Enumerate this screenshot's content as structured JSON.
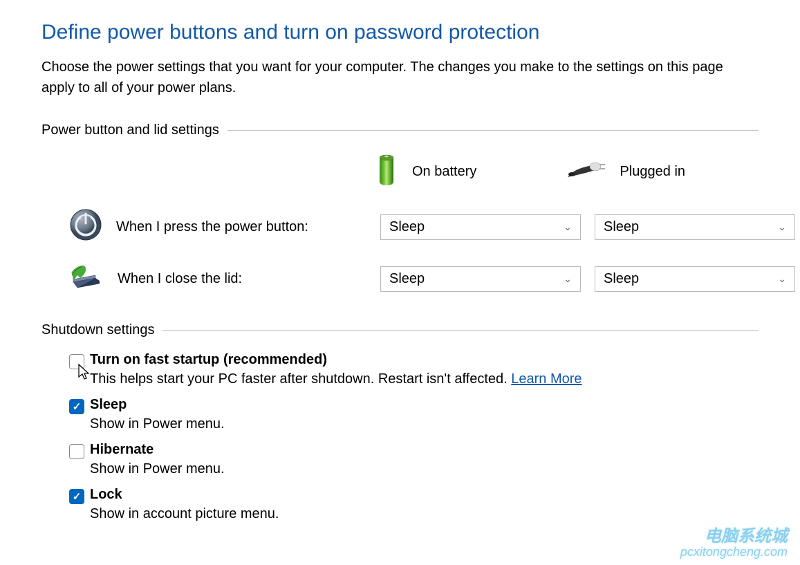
{
  "title": "Define power buttons and turn on password protection",
  "description": "Choose the power settings that you want for your computer. The changes you make to the settings on this page apply to all of your power plans.",
  "section1": {
    "label": "Power button and lid settings",
    "headers": {
      "battery": "On battery",
      "plugged": "Plugged in"
    },
    "rows": {
      "power_button": {
        "label": "When I press the power button:",
        "battery_value": "Sleep",
        "plugged_value": "Sleep"
      },
      "close_lid": {
        "label": "When I close the lid:",
        "battery_value": "Sleep",
        "plugged_value": "Sleep"
      }
    }
  },
  "section2": {
    "label": "Shutdown settings",
    "items": {
      "fast_startup": {
        "checked": false,
        "title": "Turn on fast startup (recommended)",
        "desc_prefix": "This helps start your PC faster after shutdown. Restart isn't affected. ",
        "link": "Learn More"
      },
      "sleep": {
        "checked": true,
        "title": "Sleep",
        "desc": "Show in Power menu."
      },
      "hibernate": {
        "checked": false,
        "title": "Hibernate",
        "desc": "Show in Power menu."
      },
      "lock": {
        "checked": true,
        "title": "Lock",
        "desc": "Show in account picture menu."
      }
    }
  },
  "watermark": {
    "top": "电脑系统城",
    "bottom": "pcxitongcheng.com"
  }
}
